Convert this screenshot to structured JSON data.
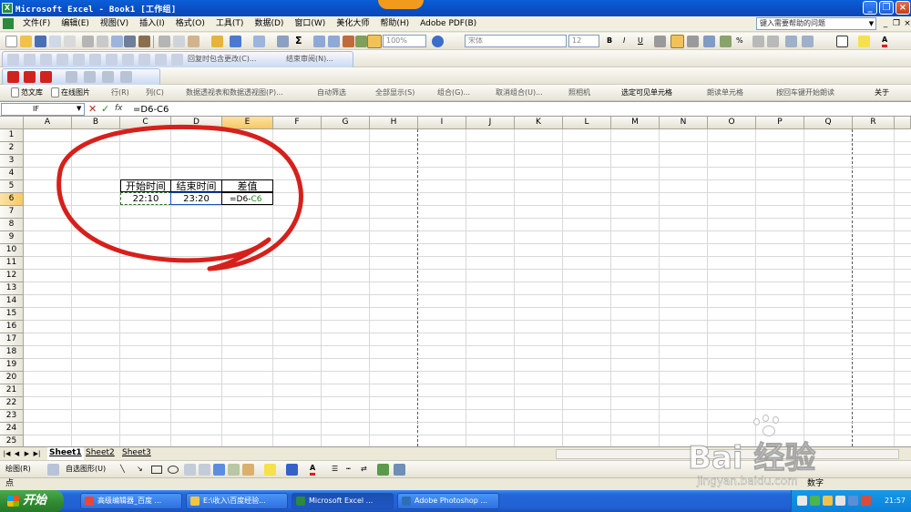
{
  "window": {
    "title": "Microsoft Excel - Book1  [工作组]",
    "app_icon": "excel-icon",
    "controls": [
      "_",
      "❐",
      "×"
    ]
  },
  "menu": {
    "items": [
      "文件(F)",
      "编辑(E)",
      "视图(V)",
      "插入(I)",
      "格式(O)",
      "工具(T)",
      "数据(D)",
      "窗口(W)",
      "美化大师",
      "帮助(H)",
      "Adobe PDF(B)"
    ],
    "help_placeholder": "键入需要帮助的问题",
    "doc_controls": [
      "_",
      "❐",
      "×"
    ]
  },
  "toolbar_standard": {
    "zoom": "100%",
    "font_name": "宋体",
    "font_size": "12"
  },
  "toolbar_review": {
    "reply_label": "回复时包含更改(C)...",
    "end_review_label": "结束审阅(N)..."
  },
  "toolbar_custom": {
    "items": [
      "范文库",
      "在线图片",
      "行(R)",
      "列(C)",
      "数据透视表和数据透视图(P)...",
      "自动筛选",
      "全部显示(S)",
      "组合(G)...",
      "取消组合(U)...",
      "照相机",
      "选定可见单元格",
      "朗读单元格",
      "按回车键开始朗读",
      "关于"
    ]
  },
  "formula_bar": {
    "name_box": "IF",
    "formula": "=D6-C6"
  },
  "grid": {
    "columns": [
      "A",
      "B",
      "C",
      "D",
      "E",
      "F",
      "G",
      "H",
      "I",
      "J",
      "K",
      "L",
      "M",
      "N",
      "O",
      "P",
      "Q",
      "R"
    ],
    "selected_column": "E",
    "rows": [
      "1",
      "2",
      "3",
      "4",
      "5",
      "6",
      "7",
      "8",
      "9",
      "10",
      "11",
      "12",
      "13",
      "14",
      "15",
      "16",
      "17",
      "18",
      "19",
      "20",
      "21",
      "22",
      "23",
      "24",
      "25"
    ],
    "selected_row": "6",
    "cells": {
      "C5": "开始时间",
      "D5": "结束时间",
      "E5": "差值",
      "C6": "22:10",
      "D6": "23:20",
      "E6_prefix": "=D6-",
      "E6_ref": "C6"
    },
    "annotation_color": "#d6201c"
  },
  "sheets": {
    "tabs": [
      "Sheet1",
      "Sheet2",
      "Sheet3"
    ],
    "active": "Sheet1"
  },
  "drawing_toolbar": {
    "draw_label": "绘图(R)",
    "autoshape_label": "自选图形(U)"
  },
  "status": {
    "mode": "点",
    "indicator": "数字"
  },
  "taskbar": {
    "start_label": "开始",
    "tasks": [
      {
        "label": "高级编辑器_百度 ...",
        "icon": "chrome-icon",
        "color": "#e8453c"
      },
      {
        "label": "E:\\收入\\百度经验...",
        "icon": "folder-icon",
        "color": "#f3c63f"
      },
      {
        "label": "Microsoft Excel ...",
        "icon": "excel-icon",
        "color": "#2b8a3e"
      },
      {
        "label": "Adobe Photoshop ...",
        "icon": "photoshop-icon",
        "color": "#2d6fb7"
      }
    ],
    "clock": "21:57"
  },
  "watermark": {
    "brand": "Bai 经验",
    "url": "jingyan.baidu.com"
  }
}
